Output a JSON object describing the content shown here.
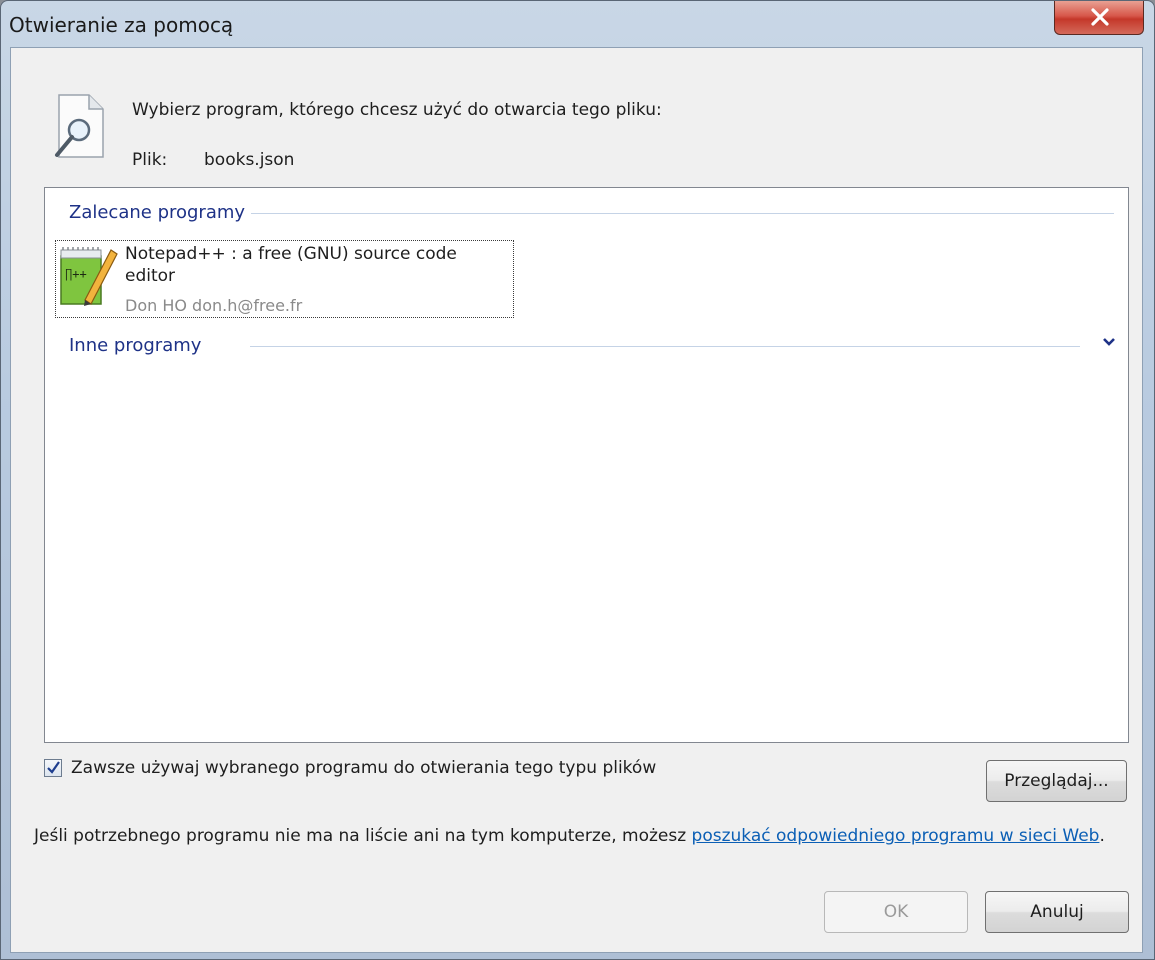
{
  "window": {
    "title": "Otwieranie za pomocą",
    "close_label": "X"
  },
  "header": {
    "prompt": "Wybierz program, którego chcesz użyć do otwarcia tego pliku:",
    "file_label": "Plik:",
    "file_name": "books.json"
  },
  "list": {
    "recommended_header": "Zalecane programy",
    "other_header": "Inne programy",
    "recommended_items": [
      {
        "name": "Notepad++ : a free (GNU) source code editor",
        "publisher": "Don HO don.h@free.fr",
        "icon": "notepad-plus-plus-icon"
      }
    ]
  },
  "options": {
    "always_use_label": "Zawsze używaj wybranego programu do otwierania tego typu plików",
    "always_use_checked": true,
    "browse_label": "Przeglądaj..."
  },
  "info": {
    "text_before_link": "Jeśli potrzebnego programu nie ma na liście ani na tym komputerze, możesz ",
    "link_text": "poszukać odpowiedniego programu w sieci Web",
    "text_after_link": "."
  },
  "buttons": {
    "ok_label": "OK",
    "cancel_label": "Anuluj"
  },
  "colors": {
    "group_header": "#1e3287",
    "link": "#0b5fb5",
    "close_button": "#c4382a"
  }
}
